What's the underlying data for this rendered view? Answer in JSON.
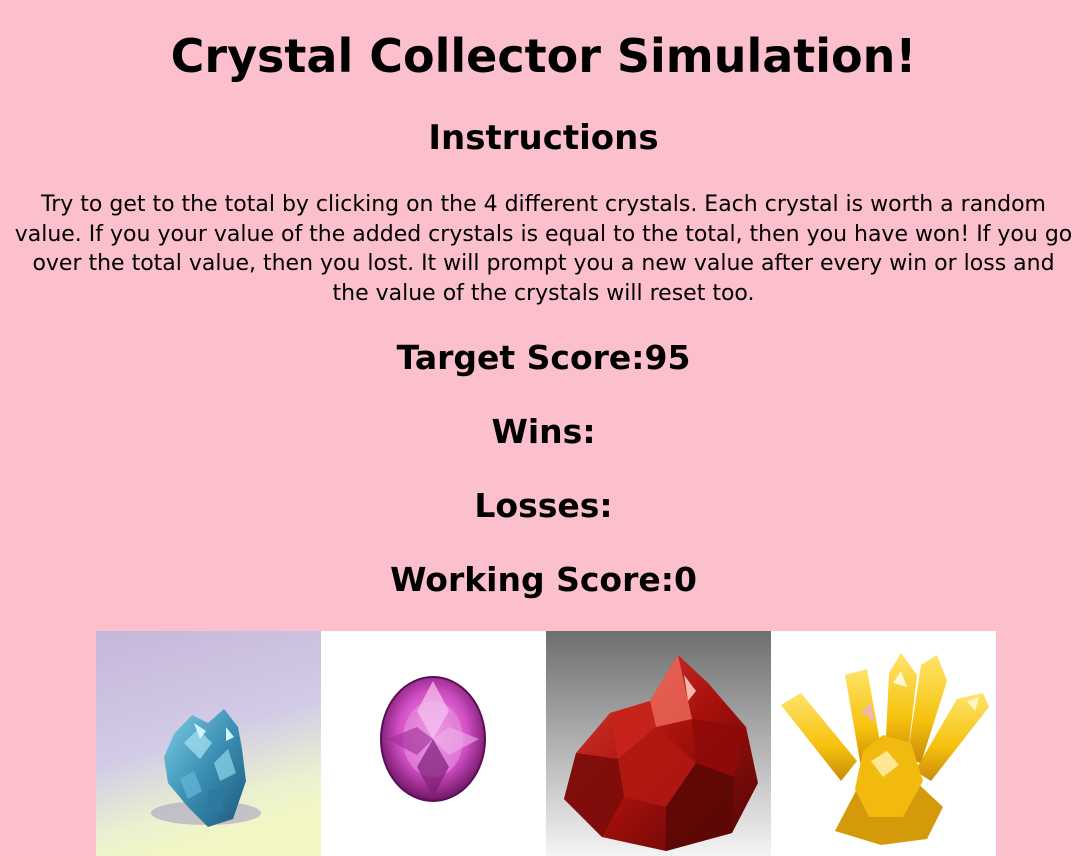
{
  "title": "Crystal Collector Simulation!",
  "instructions_heading": "Instructions",
  "instructions_text": "Try to get to the total by clicking on the 4 different crystals. Each crystal is worth a random value. If you your value of the added crystals is equal to the total, then you have won! If you go over the total value, then you lost. It will prompt you a new value after every win or loss and the value of the crystals will reset too.",
  "stats": {
    "target_label": "Target Score:",
    "target_value": "95",
    "wins_label": "Wins:",
    "wins_value": "",
    "losses_label": "Losses:",
    "losses_value": "",
    "working_label": "Working Score:",
    "working_value": "0"
  },
  "crystals": [
    {
      "icon": "blue-crystal-icon",
      "color": "#3a8fb0"
    },
    {
      "icon": "pink-gem-icon",
      "color": "#d24fc4"
    },
    {
      "icon": "red-crystal-icon",
      "color": "#a8100c"
    },
    {
      "icon": "yellow-crystal-icon",
      "color": "#f6c20e"
    }
  ]
}
